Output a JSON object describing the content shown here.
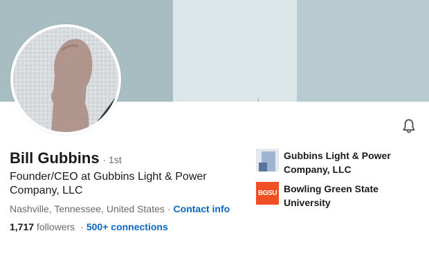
{
  "profile": {
    "name": "Bill Gubbins",
    "degree": "· 1st",
    "headline": "Founder/CEO at Gubbins Light & Power Company, LLC",
    "location": "Nashville, Tennessee, United States",
    "location_separator": "·",
    "contact_info_label": "Contact info",
    "followers_count": "1,717",
    "followers_label": "followers",
    "stats_separator": "·",
    "connections_label": "500+ connections"
  },
  "organizations": [
    {
      "name": "Gubbins Light & Power Company, LLC",
      "logo": "company-logo"
    },
    {
      "name": "Bowling Green State University",
      "logo": "school-logo",
      "logo_text": "BGSU"
    }
  ],
  "icons": {
    "notification": "bell-icon"
  },
  "colors": {
    "link": "#0a66c2",
    "banner": "#a8bdc2",
    "school_logo": "#f04e23"
  }
}
